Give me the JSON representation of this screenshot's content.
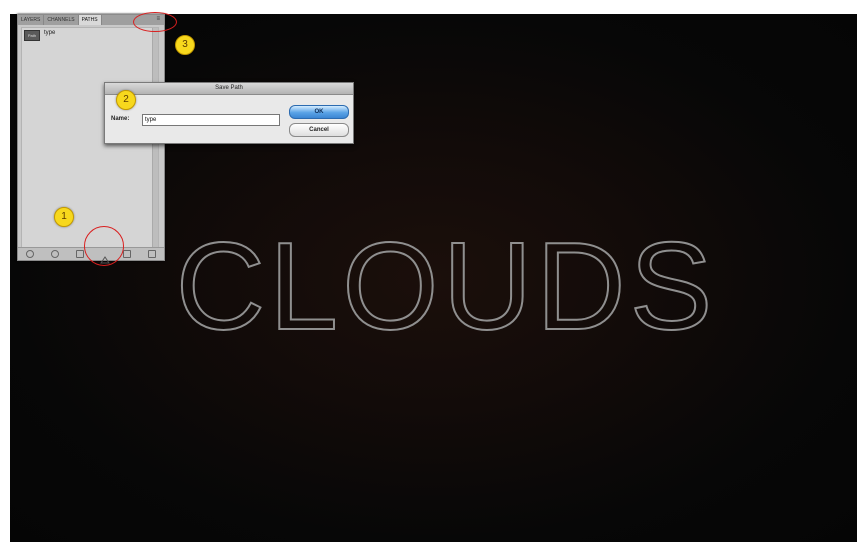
{
  "canvas": {
    "title": "CLOUDS"
  },
  "panel": {
    "tabs": [
      "LAYERS",
      "CHANNELS",
      "PATHS"
    ],
    "active_tab": "PATHS",
    "menu_icon": "panel-menu-icon",
    "path_row": {
      "thumb": "Path",
      "name": "type"
    },
    "footer_icons": [
      "fill-path-icon",
      "stroke-path-icon",
      "load-selection-icon",
      "make-work-path-icon",
      "new-path-icon",
      "delete-path-icon"
    ]
  },
  "dialog": {
    "title": "Save Path",
    "name_label": "Name:",
    "name_value": "type",
    "ok_label": "OK",
    "cancel_label": "Cancel"
  },
  "annotations": {
    "badge1": "1",
    "badge2": "2",
    "badge3": "3"
  },
  "colors": {
    "ring": "#d91f1f",
    "badge": "#f7d81d",
    "ok_button": "#3b86d3"
  }
}
